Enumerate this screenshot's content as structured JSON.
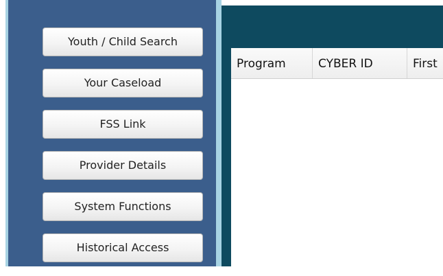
{
  "sidebar": {
    "buttons": [
      {
        "label": "Youth / Child Search"
      },
      {
        "label": "Your Caseload"
      },
      {
        "label": "FSS Link"
      },
      {
        "label": "Provider Details"
      },
      {
        "label": "System Functions"
      },
      {
        "label": "Historical Access"
      }
    ]
  },
  "grid": {
    "columns": [
      "Program",
      "CYBER ID",
      "First"
    ]
  },
  "colors": {
    "sidebar_bg": "#3b5e8c",
    "edge_light": "#a7d3e3",
    "main_header": "#0e4a5f"
  }
}
